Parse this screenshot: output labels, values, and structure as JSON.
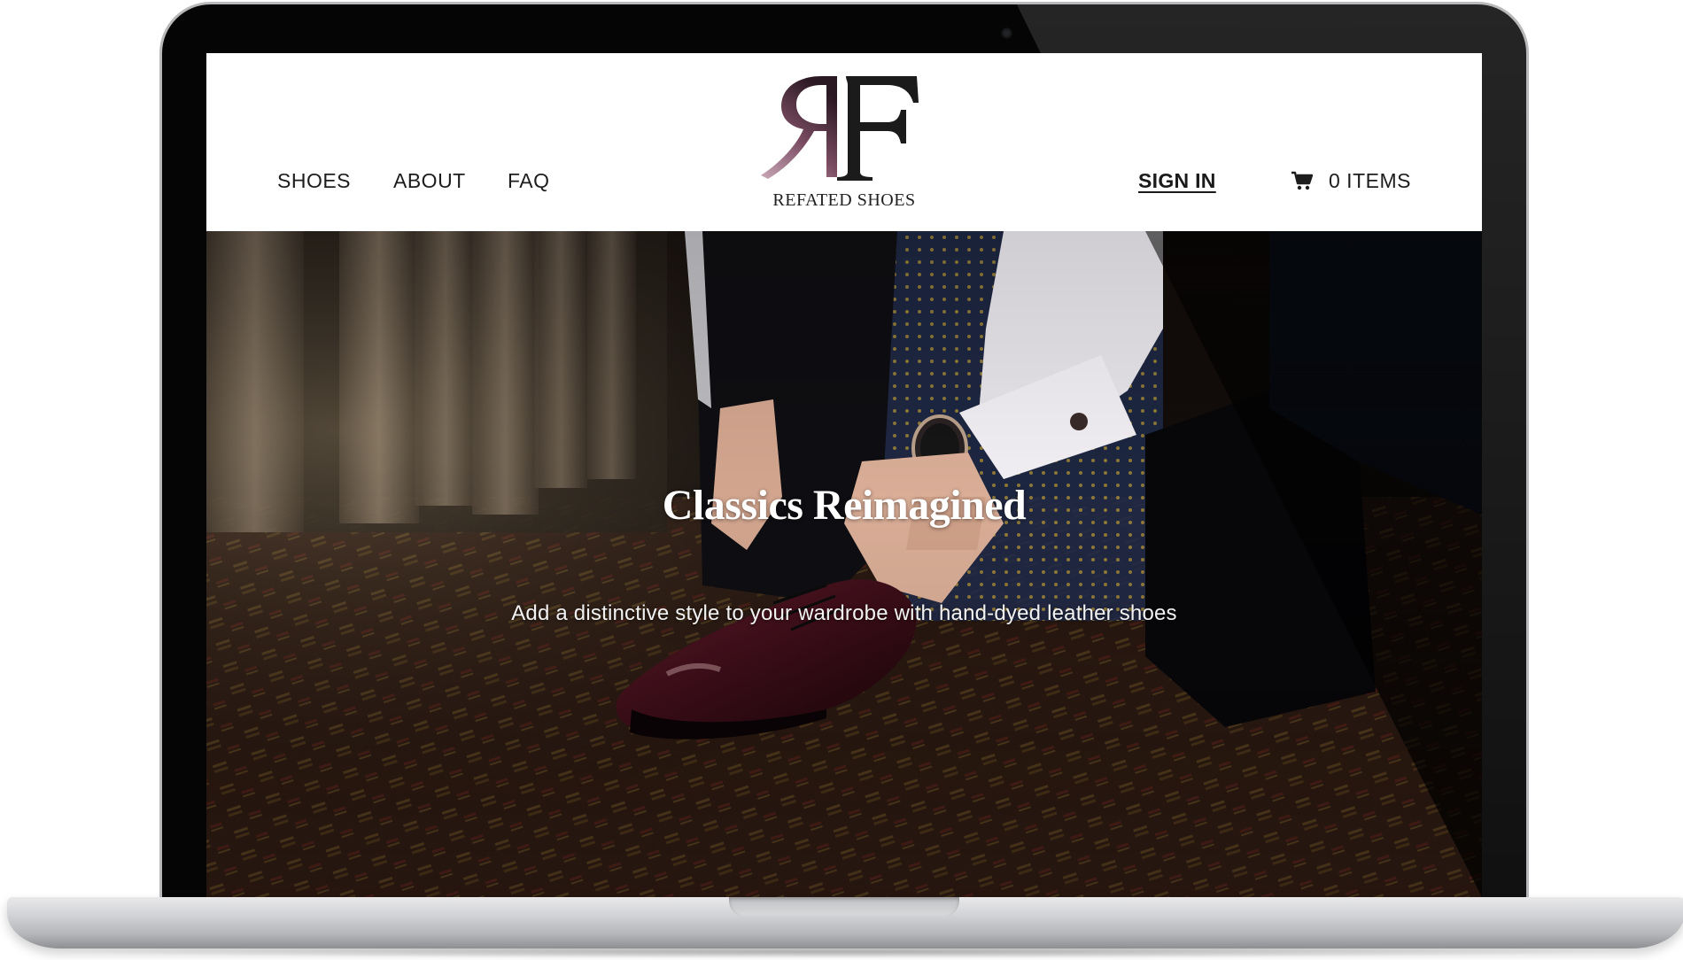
{
  "nav": {
    "shoes": "SHOES",
    "about": "ABOUT",
    "faq": "FAQ"
  },
  "logo": {
    "monogram": "RF",
    "brand_name": "REFATED SHOES",
    "accent_color": "#6b3f55"
  },
  "account": {
    "sign_in": "SIGN IN"
  },
  "cart": {
    "label": "0 ITEMS",
    "icon": "cart-icon"
  },
  "hero": {
    "title": "Classics Reimagined",
    "subtitle": "Add a distinctive style to your wardrobe with hand-dyed leather shoes",
    "image": "man-tying-burgundy-oxford-shoe-photo"
  }
}
